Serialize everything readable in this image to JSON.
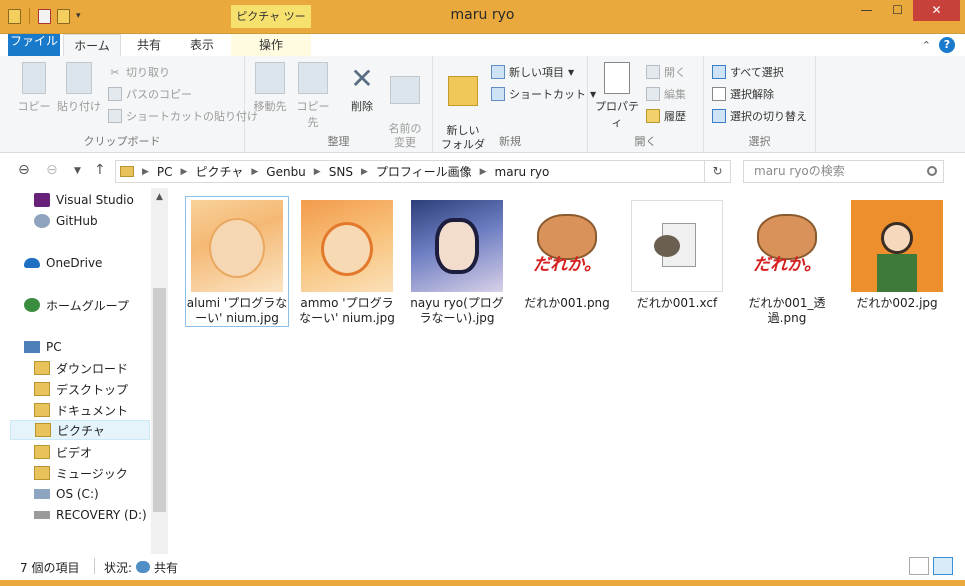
{
  "window": {
    "title": "maru ryo",
    "contextual_tab_group": "ピクチャ ツール",
    "controls": {
      "minimize": "—",
      "maximize": "☐",
      "close": "✕"
    }
  },
  "tabs": {
    "file": "ファイル",
    "home": "ホーム",
    "share": "共有",
    "view": "表示",
    "manage": "操作"
  },
  "ribbon": {
    "clipboard": {
      "label": "クリップボード",
      "copy": "コピー",
      "paste": "貼り付け",
      "cut": "切り取り",
      "copy_path": "パスのコピー",
      "paste_shortcut": "ショートカットの貼り付け"
    },
    "organize": {
      "label": "整理",
      "move_to": "移動先",
      "copy_to": "コピー先",
      "delete": "削除",
      "rename": "名前の\n変更"
    },
    "new": {
      "label": "新規",
      "new_folder": "新しい\nフォルダー",
      "new_item": "新しい項目",
      "shortcut": "ショートカット"
    },
    "open": {
      "label": "開く",
      "properties": "プロパティ",
      "open": "開く",
      "edit": "編集",
      "history": "履歴"
    },
    "select": {
      "label": "選択",
      "select_all": "すべて選択",
      "select_none": "選択解除",
      "invert": "選択の切り替え"
    }
  },
  "address": {
    "path": [
      "PC",
      "ピクチャ",
      "Genbu",
      "SNS",
      "プロフィール画像",
      "maru ryo"
    ],
    "search_placeholder": "maru ryoの検索"
  },
  "nav": {
    "items": [
      {
        "label": "Visual Studio",
        "icon": "visual-studio-icon",
        "color": "#68217a"
      },
      {
        "label": "GitHub",
        "icon": "github-icon",
        "color": "#8ea3bd"
      },
      {
        "label": "OneDrive",
        "icon": "onedrive-icon",
        "color": "#1f6fc5"
      },
      {
        "label": "ホームグループ",
        "icon": "homegroup-icon",
        "color": "#3a8d3e"
      },
      {
        "label": "PC",
        "icon": "pc-icon",
        "color": "#4f7fb8"
      },
      {
        "label": "ダウンロード",
        "icon": "downloads-folder-icon",
        "color": "#e8c25a"
      },
      {
        "label": "デスクトップ",
        "icon": "desktop-folder-icon",
        "color": "#e8c25a"
      },
      {
        "label": "ドキュメント",
        "icon": "documents-folder-icon",
        "color": "#e8c25a"
      },
      {
        "label": "ピクチャ",
        "icon": "pictures-folder-icon",
        "color": "#e8c25a"
      },
      {
        "label": "ビデオ",
        "icon": "videos-folder-icon",
        "color": "#e8c25a"
      },
      {
        "label": "ミュージック",
        "icon": "music-folder-icon",
        "color": "#e8c25a"
      },
      {
        "label": "OS (C:)",
        "icon": "drive-c-icon",
        "color": "#8da5c0"
      },
      {
        "label": "RECOVERY (D:)",
        "icon": "drive-d-icon",
        "color": "#9a9a9a"
      }
    ],
    "selected": "ピクチャ"
  },
  "files": [
    {
      "name": "alumi 'プログラなーい' nium.jpg",
      "thumb": "anime-girl-thumbnail"
    },
    {
      "name": "ammo 'プログラなーい' nium.jpg",
      "thumb": "anime-boy-thumbnail"
    },
    {
      "name": "nayu ryo(プログラなーい).jpg",
      "thumb": "anime-girl-dark-hair-thumbnail"
    },
    {
      "name": "だれか001.png",
      "thumb": "bear-logo-thumbnail"
    },
    {
      "name": "だれか001.xcf",
      "thumb": "gimp-file-thumbnail"
    },
    {
      "name": "だれか001_透過.png",
      "thumb": "bear-logo-thumbnail"
    },
    {
      "name": "だれか002.jpg",
      "thumb": "character-orange-bg-thumbnail"
    }
  ],
  "logo_text": "だれか。",
  "status": {
    "count": "7 個の項目",
    "state_label": "状況:",
    "state_value": "共有"
  },
  "colors": {
    "titlebar": "#e9a93c",
    "file_tab": "#1979ca",
    "close_button": "#c7413a",
    "selection": "#e5f3fb"
  }
}
